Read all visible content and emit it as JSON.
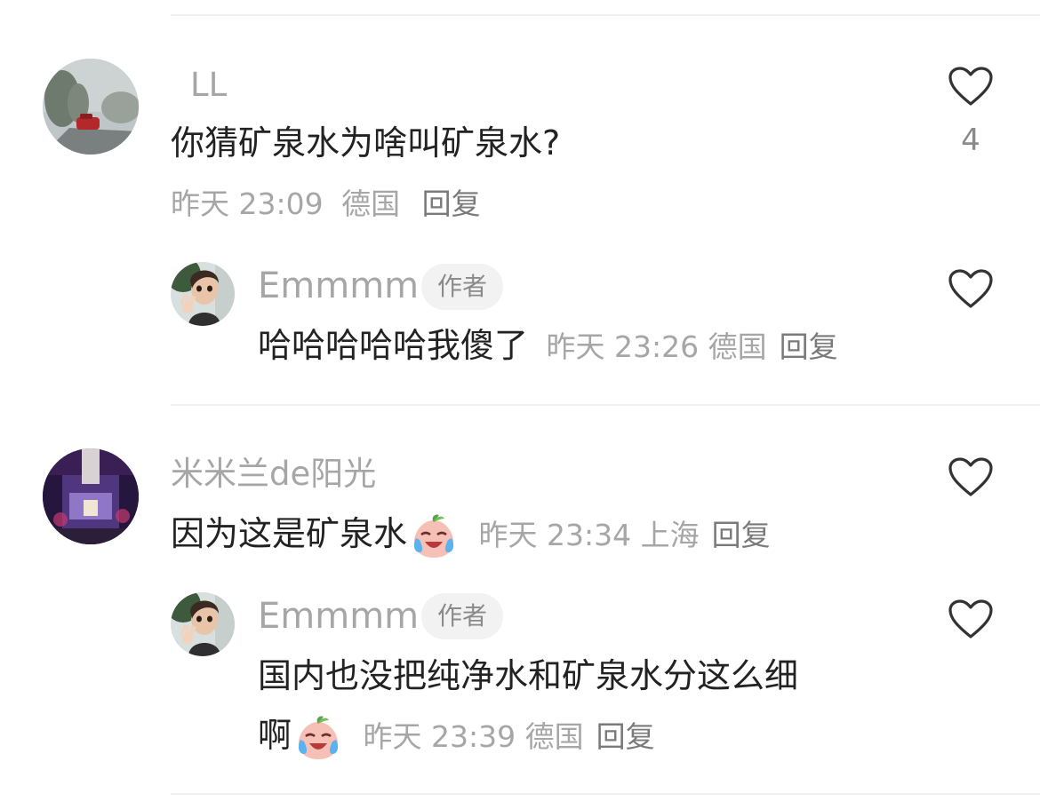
{
  "comments": [
    {
      "user": "LL",
      "text": "你猜矿泉水为啥叫矿泉水?",
      "time": "昨天 23:09",
      "location": "德国",
      "reply_label": "回复",
      "likes": "4",
      "reply": {
        "user": "Emmmm",
        "badge": "作者",
        "text": "哈哈哈哈哈我傻了",
        "time": "昨天 23:26",
        "location": "德国",
        "reply_label": "回复"
      }
    },
    {
      "user": "米米兰de阳光",
      "text": "因为这是矿泉水",
      "emoji": "crying-laughing-peach-emoji",
      "time": "昨天 23:34",
      "location": "上海",
      "reply_label": "回复",
      "reply": {
        "user": "Emmmm",
        "badge": "作者",
        "text_line1": "国内也没把纯净水和矿泉水分这么细",
        "text_line2": "啊",
        "emoji": "crying-laughing-peach-emoji",
        "time": "昨天 23:39",
        "location": "德国",
        "reply_label": "回复"
      }
    }
  ],
  "icons": {
    "like": "heart-outline-icon"
  },
  "colors": {
    "text": "#222222",
    "muted": "#a6a6a6",
    "badge_bg": "#f2f2f2"
  }
}
